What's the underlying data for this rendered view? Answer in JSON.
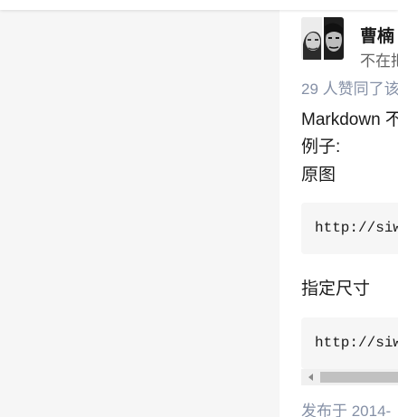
{
  "answer": {
    "author": {
      "name": "曹楠",
      "bio": "不在把"
    },
    "votes_text": "29 人赞同了该",
    "content": {
      "intro": "Markdown 不",
      "example_label": "例子:",
      "original_label": "原图",
      "code_original": "http://siw",
      "resize_label": "指定尺寸",
      "code_resized": "http://siw"
    },
    "published_text": "发布于 2014-"
  },
  "colors": {
    "page_background": "#f6f6f6",
    "card_background": "#ffffff",
    "meta_text": "#8590a6",
    "body_text": "#1a1a1a",
    "code_background": "#f6f6f6"
  },
  "icons": {
    "avatar": "author-avatar-photo",
    "scroll_left": "scroll-left-arrow-icon"
  }
}
